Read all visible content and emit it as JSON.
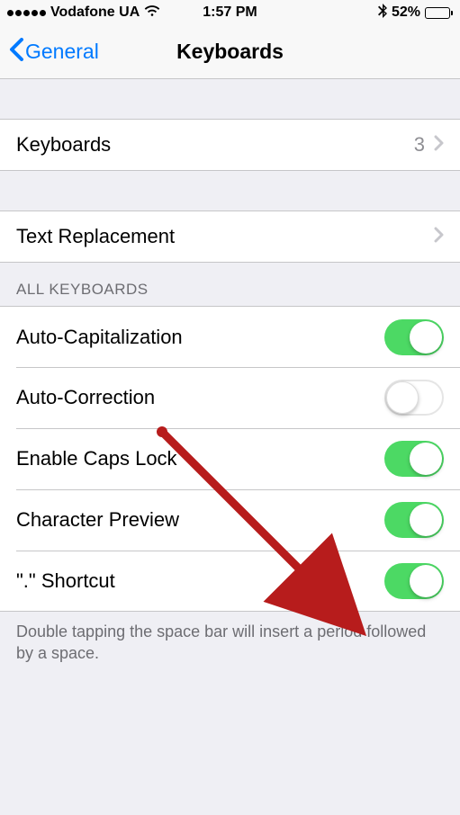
{
  "status_bar": {
    "carrier": "Vodafone UA",
    "time": "1:57 PM",
    "battery_pct": "52%"
  },
  "nav": {
    "back_label": "General",
    "title": "Keyboards"
  },
  "rows": {
    "keyboards": {
      "label": "Keyboards",
      "value": "3"
    },
    "text_replacement": {
      "label": "Text Replacement"
    }
  },
  "section_header": "ALL KEYBOARDS",
  "toggles": {
    "auto_cap": {
      "label": "Auto-Capitalization",
      "on": true
    },
    "auto_correct": {
      "label": "Auto-Correction",
      "on": false
    },
    "caps_lock": {
      "label": "Enable Caps Lock",
      "on": true
    },
    "char_preview": {
      "label": "Character Preview",
      "on": true
    },
    "period_shortcut": {
      "label": "\".\" Shortcut",
      "on": true
    }
  },
  "footer": "Double tapping the space bar will insert a period followed by a space.",
  "annotation": {
    "color": "#b71c1c"
  }
}
